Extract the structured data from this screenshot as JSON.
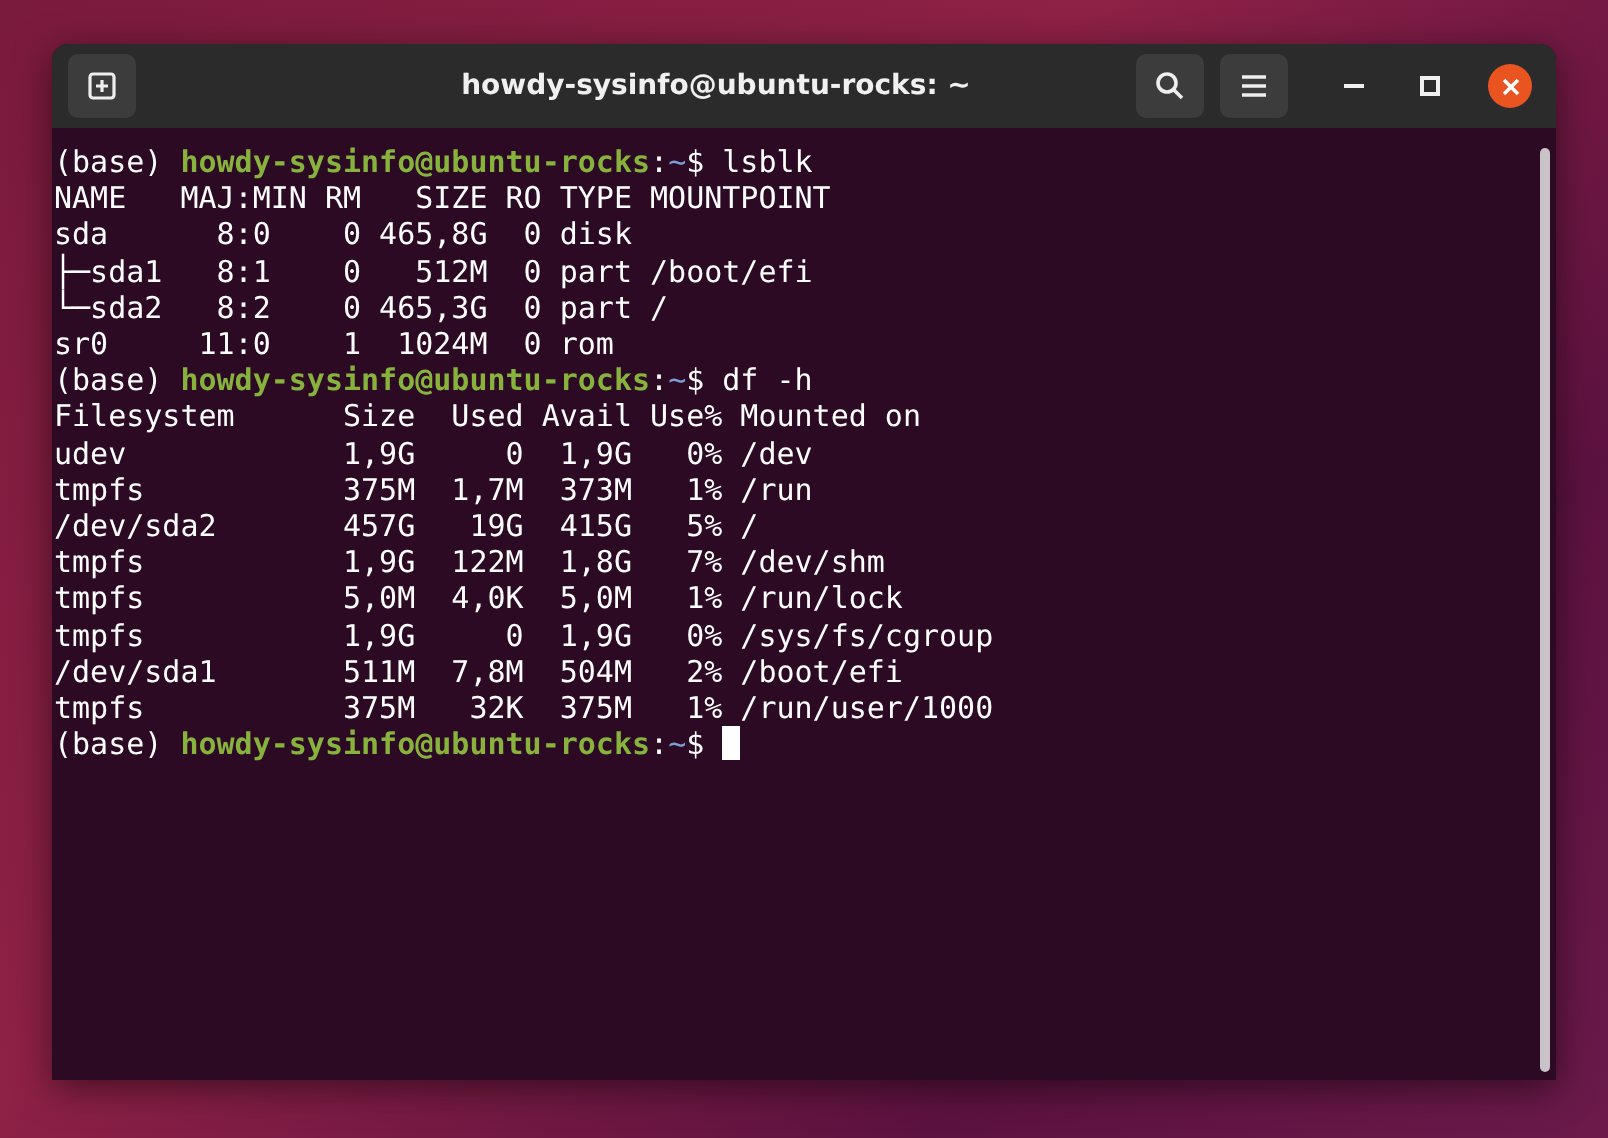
{
  "window": {
    "title": "howdy-sysinfo@ubuntu-rocks: ~"
  },
  "terminal": {
    "lines": [
      {
        "kind": "prompt",
        "env": "(base)",
        "user_host": "howdy-sysinfo@ubuntu-rocks",
        "separator": ":",
        "path": "~",
        "symbol": "$",
        "command": "lsblk",
        "cursor": false
      },
      {
        "kind": "output",
        "text": "NAME   MAJ:MIN RM   SIZE RO TYPE MOUNTPOINT"
      },
      {
        "kind": "output",
        "text": "sda      8:0    0 465,8G  0 disk "
      },
      {
        "kind": "output",
        "text": "├─sda1   8:1    0   512M  0 part /boot/efi"
      },
      {
        "kind": "output",
        "text": "└─sda2   8:2    0 465,3G  0 part /"
      },
      {
        "kind": "output",
        "text": "sr0     11:0    1  1024M  0 rom  "
      },
      {
        "kind": "prompt",
        "env": "(base)",
        "user_host": "howdy-sysinfo@ubuntu-rocks",
        "separator": ":",
        "path": "~",
        "symbol": "$",
        "command": "df -h",
        "cursor": false
      },
      {
        "kind": "output",
        "text": "Filesystem      Size  Used Avail Use% Mounted on"
      },
      {
        "kind": "output",
        "text": "udev            1,9G     0  1,9G   0% /dev"
      },
      {
        "kind": "output",
        "text": "tmpfs           375M  1,7M  373M   1% /run"
      },
      {
        "kind": "output",
        "text": "/dev/sda2       457G   19G  415G   5% /"
      },
      {
        "kind": "output",
        "text": "tmpfs           1,9G  122M  1,8G   7% /dev/shm"
      },
      {
        "kind": "output",
        "text": "tmpfs           5,0M  4,0K  5,0M   1% /run/lock"
      },
      {
        "kind": "output",
        "text": "tmpfs           1,9G     0  1,9G   0% /sys/fs/cgroup"
      },
      {
        "kind": "output",
        "text": "/dev/sda1       511M  7,8M  504M   2% /boot/efi"
      },
      {
        "kind": "output",
        "text": "tmpfs           375M   32K  375M   1% /run/user/1000"
      },
      {
        "kind": "prompt",
        "env": "(base)",
        "user_host": "howdy-sysinfo@ubuntu-rocks",
        "separator": ":",
        "path": "~",
        "symbol": "$",
        "cursor": true
      }
    ]
  }
}
